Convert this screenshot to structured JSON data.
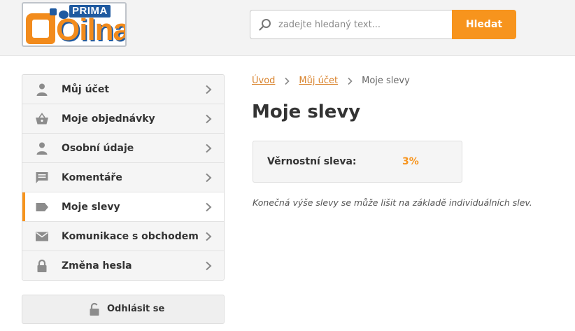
{
  "header": {
    "logo": {
      "top_text": "PRIMA",
      "main_text": "Oilna"
    },
    "search": {
      "placeholder": "zadejte hledaný text...",
      "value": "",
      "button_label": "Hledat"
    }
  },
  "sidebar": {
    "items": [
      {
        "label": "Můj účet",
        "icon": "user-icon",
        "active": false
      },
      {
        "label": "Moje objednávky",
        "icon": "basket-icon",
        "active": false
      },
      {
        "label": "Osobní údaje",
        "icon": "user-icon",
        "active": false
      },
      {
        "label": "Komentáře",
        "icon": "comment-icon",
        "active": false
      },
      {
        "label": "Moje slevy",
        "icon": "tag-icon",
        "active": true
      },
      {
        "label": "Komunikace s obchodem",
        "icon": "envelope-icon",
        "active": false
      },
      {
        "label": "Změna hesla",
        "icon": "lock-icon",
        "active": false
      }
    ],
    "logout_label": "Odhlásit se"
  },
  "breadcrumb": {
    "home": "Úvod",
    "account": "Můj účet",
    "current": "Moje slevy"
  },
  "main": {
    "title": "Moje slevy",
    "discount": {
      "label": "Věrnostní sleva:",
      "value": "3%"
    },
    "note": "Konečná výše slevy se může lišit na základě individuálních slev."
  },
  "colors": {
    "accent": "#f7941d",
    "link": "#d9822b",
    "logo_blue": "#1f5aa0",
    "icon_gray": "#8c8c8c"
  }
}
